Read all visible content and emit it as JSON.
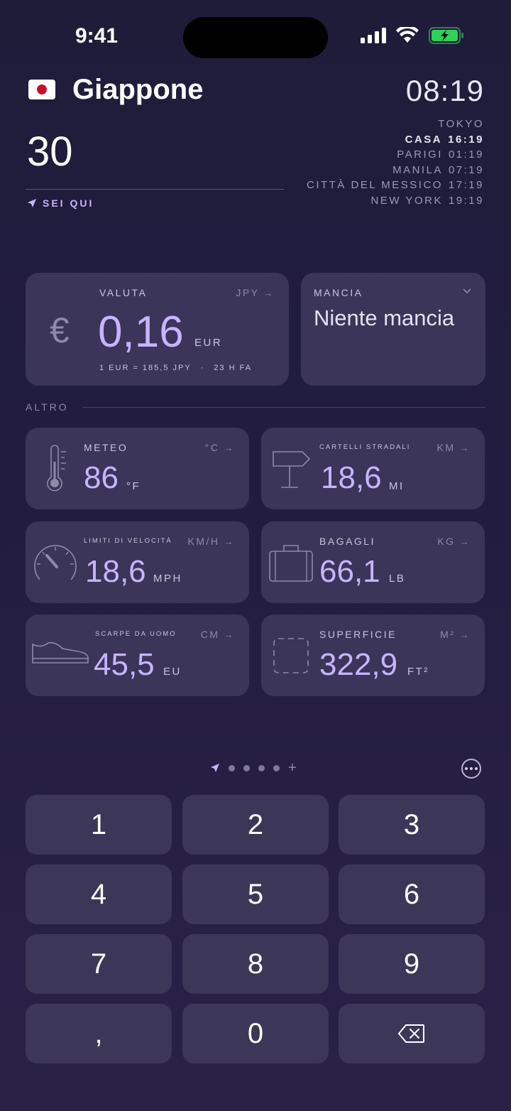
{
  "status": {
    "time": "9:41"
  },
  "header": {
    "country": "Giappone",
    "amount": "30",
    "here_label": "SEI QUI",
    "local_time": "08:19",
    "clocks": [
      {
        "city": "TOKYO",
        "time": "",
        "home": false
      },
      {
        "city": "CASA",
        "time": "16:19",
        "home": true
      },
      {
        "city": "PARIGI",
        "time": "01:19",
        "home": false
      },
      {
        "city": "MANILA",
        "time": "07:19",
        "home": false
      },
      {
        "city": "CITTÀ DEL MESSICO",
        "time": "17:19",
        "home": false
      },
      {
        "city": "NEW YORK",
        "time": "19:19",
        "home": false
      }
    ]
  },
  "currency": {
    "label": "VALUTA",
    "unit_top": "JPY",
    "symbol": "€",
    "value": "0,16",
    "unit": "EUR",
    "rate": "1 EUR = 185,5 JPY",
    "updated": "23 H FA"
  },
  "tip": {
    "label": "MANCIA",
    "value": "Niente mancia"
  },
  "section": {
    "label": "ALTRO"
  },
  "cards": {
    "weather": {
      "label": "METEO",
      "unit_top": "°C",
      "value": "86",
      "unit": "°F"
    },
    "signs": {
      "label": "CARTELLI STRADALI",
      "unit_top": "KM",
      "value": "18,6",
      "unit": "MI"
    },
    "speed": {
      "label": "LIMITI DI VELOCITÀ",
      "unit_top": "KM/H",
      "value": "18,6",
      "unit": "MPH"
    },
    "luggage": {
      "label": "BAGAGLI",
      "unit_top": "KG",
      "value": "66,1",
      "unit": "LB"
    },
    "shoes": {
      "label": "SCARPE DA UOMO",
      "unit_top": "CM",
      "value": "45,5",
      "unit": "EU"
    },
    "area": {
      "label": "SUPERFICIE",
      "unit_top": "M²",
      "value": "322,9",
      "unit": "FT²"
    }
  },
  "keypad": {
    "keys": [
      "1",
      "2",
      "3",
      "4",
      "5",
      "6",
      "7",
      "8",
      "9",
      ",",
      "0"
    ]
  },
  "colors": {
    "accent": "#c7b4ff",
    "card": "#3a3559",
    "battery": "#30d158"
  }
}
